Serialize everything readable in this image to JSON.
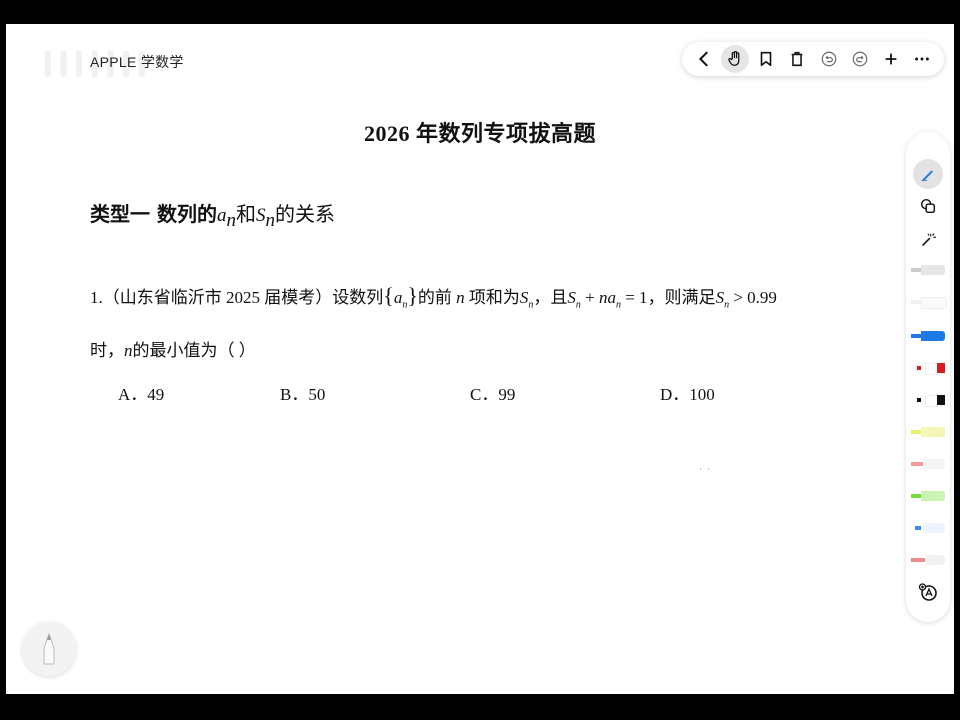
{
  "header": {
    "brand": "APPLE 学数学",
    "watermark": "lllllll"
  },
  "toolbar": {
    "buttons": [
      {
        "name": "back-icon"
      },
      {
        "name": "hand-icon",
        "active": true
      },
      {
        "name": "bookmark-icon"
      },
      {
        "name": "trash-icon"
      },
      {
        "name": "undo-icon"
      },
      {
        "name": "redo-icon"
      },
      {
        "name": "add-icon"
      },
      {
        "name": "more-icon"
      }
    ]
  },
  "document": {
    "title": "2026 年数列专项拔高题",
    "section": {
      "prefix": "类型一  数列的",
      "a": "a",
      "sub_n": "n",
      "and": "和",
      "s": "S",
      "suffix": "的关系"
    },
    "question": {
      "number": "1.",
      "source": "（山东省临沂市 2025 届模考）",
      "t1": "设数列",
      "seq": "a",
      "t2": "的前",
      "n": "n",
      "t3": "项和为",
      "S": "S",
      "t4": "，且",
      "plus": " + ",
      "na": "na",
      "eq": " = 1",
      "t5": "，则满足",
      "gt": " > 0.99",
      "t6": "时，",
      "t7": "的最小值为（    ）"
    },
    "options": [
      {
        "label": "A．",
        "value": "49"
      },
      {
        "label": "B．",
        "value": "50"
      },
      {
        "label": "C．",
        "value": "99"
      },
      {
        "label": "D．",
        "value": "100"
      }
    ],
    "stray_marks": "˙    ˙"
  },
  "colors": {
    "blue_pen": "#1e78e6",
    "red_pen": "#d81c1c",
    "black_pen": "#111111",
    "highlighter_yellow": "#e9f06a",
    "green_pen": "#6fe040",
    "eraser_pink": "#f29a9a"
  }
}
